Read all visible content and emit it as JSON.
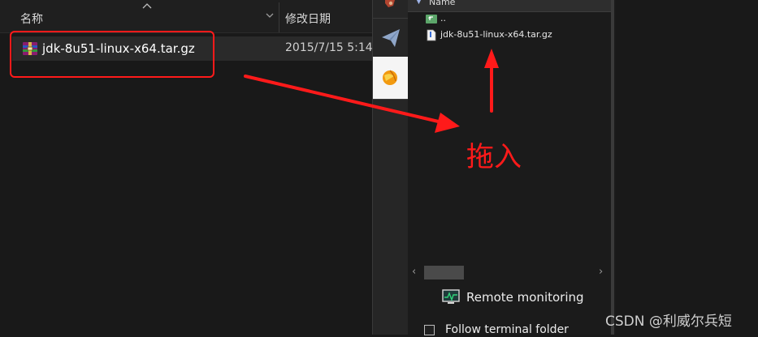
{
  "explorer": {
    "columns": {
      "name": "名称",
      "modified": "修改日期"
    },
    "file": {
      "name": "jdk-8u51-linux-x64.tar.gz",
      "modified": "2015/7/15 5:14"
    }
  },
  "sftp": {
    "header_label": "Name",
    "items": [
      {
        "label": "..",
        "icon": "folder-up-icon"
      },
      {
        "label": "jdk-8u51-linux-x64.tar.gz",
        "icon": "file-icon"
      }
    ],
    "remote_monitoring_label": "Remote monitoring",
    "follow_folder_label": "Follow terminal folder"
  },
  "annotation": {
    "drag_label": "拖入",
    "color": "#ff1a1a"
  },
  "watermark": "CSDN @利威尔兵短",
  "colors": {
    "background": "#191919",
    "annotation_red": "#ff1a1a",
    "panel": "#1b1b1b"
  }
}
